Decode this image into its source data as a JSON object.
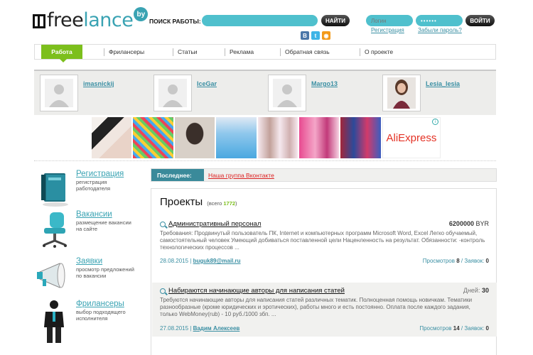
{
  "header": {
    "logo_free": "freelance",
    "logo_by": "by",
    "search_label": "ПОИСК РАБОТЫ:",
    "search_button": "НАЙТИ",
    "login_placeholder": "Логин",
    "password_value": "••••••",
    "login_button": "ВОЙТИ",
    "register_link": "Регистрация",
    "forgot_link": "Забыли пароль?",
    "social": [
      "В",
      "t",
      "◉"
    ]
  },
  "nav": {
    "items": [
      "Работа",
      "Фрилансеры",
      "Статьи",
      "Реклама",
      "Обратная связь",
      "О проекте"
    ]
  },
  "users": [
    {
      "name": "imasnickij"
    },
    {
      "name": "IceGar"
    },
    {
      "name": "Margo13"
    },
    {
      "name": "Lesia_lesia"
    }
  ],
  "ad": {
    "brand": "AliExpress",
    "info_icon": "i"
  },
  "sidebar": [
    {
      "title": "Регистрация",
      "desc": "регистрация\nработодателя"
    },
    {
      "title": "Вакансии",
      "desc": "размещение вакансии\nна сайте"
    },
    {
      "title": "Заявки",
      "desc": "просмотр предложений\nпо вакансии"
    },
    {
      "title": "Фрилансеры",
      "desc": "выбор подходящего\nисполнителя"
    }
  ],
  "latest": {
    "label": "Последнее:",
    "link": "Наша группа Вконтакте"
  },
  "projects": {
    "title": "Проекты",
    "total_prefix": "(всего",
    "total_count": "1772",
    "total_suffix": ")",
    "items": [
      {
        "title": "Административный персонал",
        "price_value": "6200000",
        "price_unit": "BYR",
        "desc": "Требования: Продвинутый пользователь ПК, Internet и компьютерных программ Microsoft Word, Excel Легко обучаемый, самостоятельный человек Умеющий добиваться поставленной цели Наценленность на результат. Обязанности: -контроль технологических процессов ...",
        "date": "28.08.2015",
        "author": "buguk89@mail.ru",
        "views_label": "Просмотров",
        "views": "8",
        "requests_label": "Заявок",
        "requests": "0"
      },
      {
        "title": "Набираются начинающие авторы для написания статей",
        "days_label": "Дней:",
        "days": "30",
        "desc": "Требуются начинающие авторы для написания статей различных тематик. Полноценная помощь новичкам. Тематики разнообразные (кроме юридических и эротических), работы много и есть постоянно. Оплата после каждого задания, только WebMoney(rub) - 10 руб./1000 збп. ...",
        "date": "27.08.2015",
        "author": "Вадим Алексеев",
        "views_label": "Просмотров",
        "views": "14",
        "requests_label": "Заявок",
        "requests": "0"
      }
    ]
  },
  "colors": {
    "accent_teal": "#3aa3b3",
    "nav_active_green": "#7cbf1c",
    "latest_label_bg": "#3a8a9a",
    "link_red": "#d22222"
  }
}
